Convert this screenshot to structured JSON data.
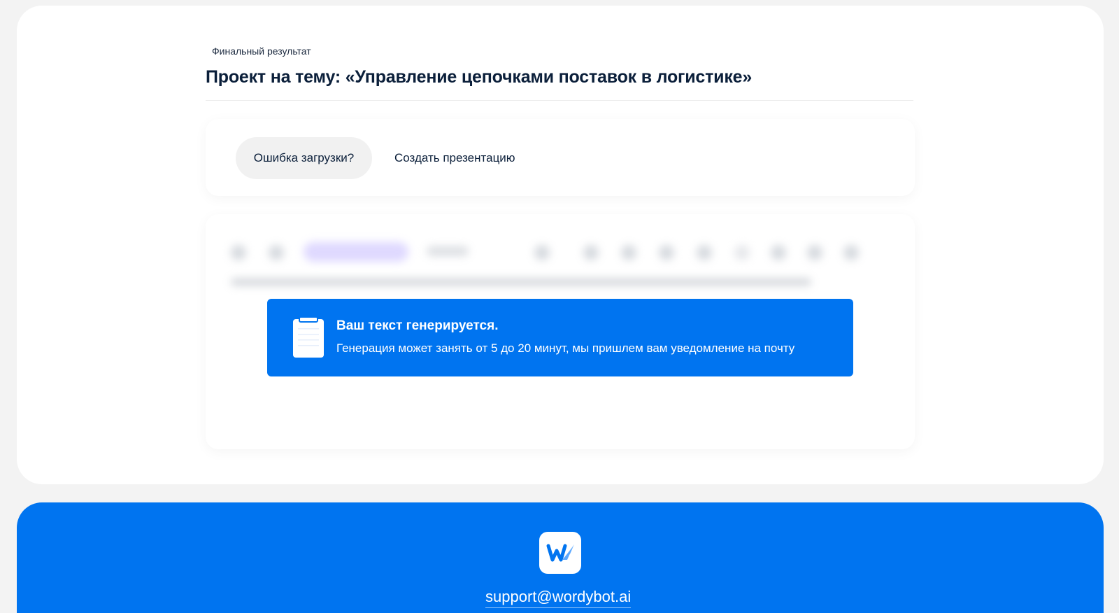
{
  "header": {
    "eyebrow": "Финальный результат",
    "title": "Проект на тему: «Управление цепочками поставок в логистике»"
  },
  "actions": {
    "error_label": "Ошибка загрузки?",
    "presentation_label": "Создать презентацию"
  },
  "notice": {
    "title": "Ваш текст генерируется.",
    "text": "Генерация может занять от 5 до 20 минут, мы пришлем вам уведомление на почту",
    "icon": "clipboard-icon"
  },
  "footer": {
    "logo_icon": "wordybot-logo-icon",
    "email": "support@wordybot.ai"
  },
  "colors": {
    "accent": "#0074f0",
    "background": "#f3f3f3",
    "card": "#ffffff",
    "heading": "#0b1f3a"
  }
}
